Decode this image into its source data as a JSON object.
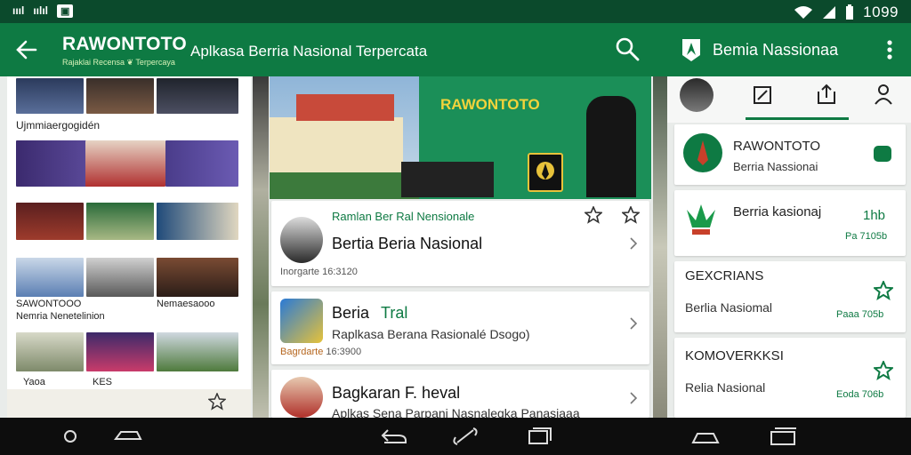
{
  "statusbar": {
    "left_items": [
      "ıııl",
      "ıılıl"
    ],
    "chip": "▣",
    "time": "1099"
  },
  "appbar": {
    "brand": "RAWONTOTO",
    "tagline": "Rajaklai Recensa ❦ Terpercaya",
    "subtitle": "Aplkasa Berria Nasional Terpercata",
    "right_title": "Bemia Nassionaa"
  },
  "grid": {
    "label1": "Ujmmiaergogidén",
    "label2a": "SAWONTOOO",
    "label2b": "Nemria Nenetelinion",
    "label2c": "Nemaesaooo",
    "label3a": "Yaoa",
    "label3b": "KES"
  },
  "hero": {
    "brand": "RAWONTOTO"
  },
  "feed": [
    {
      "kicker": "Ramlan Ber Ral Nensionale",
      "title": "Bertia Beria Nasional",
      "meta_source": "Inorgarte",
      "meta_time": "16:3120"
    },
    {
      "title_a": "Beria",
      "title_b": "Tral",
      "subtitle": "Raplkasa Berana Rasionalé Dsogo)",
      "meta_source": "Bagrdarte",
      "meta_time": "16:3900"
    },
    {
      "title": "Bagkaran F. heval",
      "subtitle": "Aplkas Sena Parpani Nasnalegka Panasiaaa"
    }
  ],
  "rpanel": {
    "cards": [
      {
        "title": "RAWONTOTO",
        "subtitle": "Berria Nassionai"
      },
      {
        "title": "Berria kasionaj",
        "badge": "1hb",
        "meta": "Pa 7105b"
      },
      {
        "title": "GEXCRIANS",
        "subtitle": "Berlia Nasiomal",
        "meta": "Paaa 705b"
      },
      {
        "title": "KOMOVERKKSI",
        "subtitle": "Relia Nasional",
        "meta": "Eoda 706b"
      }
    ]
  },
  "colors": {
    "primary": "#0e7a43",
    "status": "#0b4a2c",
    "accent": "#f2d33b",
    "navbar": "#0d0d0d"
  }
}
